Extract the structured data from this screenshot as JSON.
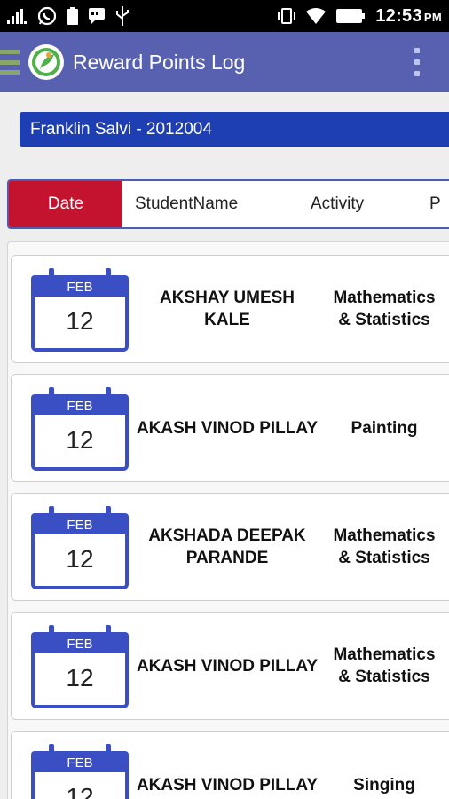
{
  "status_bar": {
    "time": "12:53",
    "ampm": "PM",
    "icons": [
      "signal-icon",
      "whatsapp-icon",
      "battery-saver-icon",
      "message-icon",
      "usb-icon",
      "vibrate-icon",
      "wifi-icon",
      "battery-icon"
    ]
  },
  "appbar": {
    "title": "Reward Points Log",
    "color": "#5860b0"
  },
  "selector": {
    "value": "Franklin Salvi - 2012004",
    "color": "#1e3fb4"
  },
  "tabs": [
    {
      "label": "Date",
      "active": true
    },
    {
      "label": "StudentName",
      "active": false
    },
    {
      "label": "Activity",
      "active": false
    },
    {
      "label": "P",
      "active": false
    }
  ],
  "accent": "#c3132f",
  "entries": [
    {
      "month": "FEB",
      "day": "12",
      "name_lines": [
        "AKSHAY UMESH",
        "KALE"
      ],
      "activity_lines": [
        "Mathematics",
        "& Statistics"
      ]
    },
    {
      "month": "FEB",
      "day": "12",
      "name_lines": [
        "AKASH VINOD PILLAY"
      ],
      "activity_lines": [
        "Painting"
      ]
    },
    {
      "month": "FEB",
      "day": "12",
      "name_lines": [
        "AKSHADA DEEPAK",
        "PARANDE"
      ],
      "activity_lines": [
        "Mathematics",
        "& Statistics"
      ]
    },
    {
      "month": "FEB",
      "day": "12",
      "name_lines": [
        "AKASH VINOD PILLAY"
      ],
      "activity_lines": [
        "Mathematics",
        "& Statistics"
      ]
    },
    {
      "month": "FEB",
      "day": "12",
      "name_lines": [
        "AKASH VINOD PILLAY"
      ],
      "activity_lines": [
        "Singing"
      ]
    }
  ]
}
